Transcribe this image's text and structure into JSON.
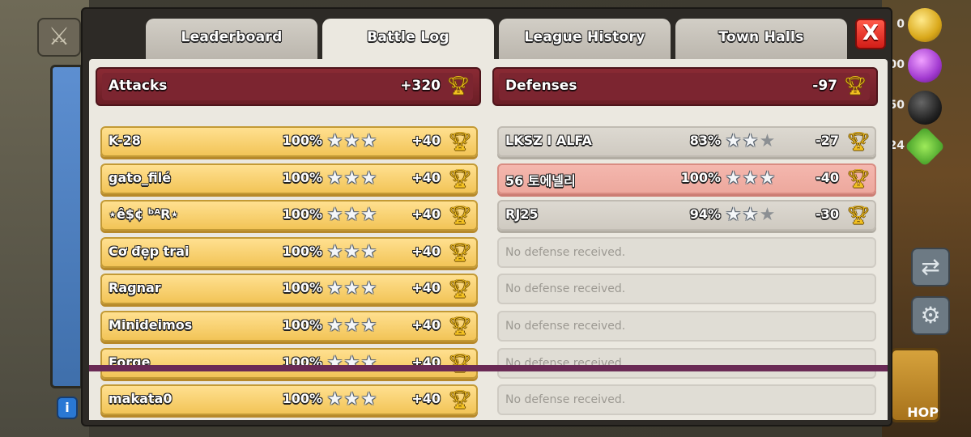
{
  "hud": {
    "resources": [
      {
        "icon": "gold-icon",
        "value": "0"
      },
      {
        "icon": "elixir-icon",
        "value": "00"
      },
      {
        "icon": "dark-elixir-icon",
        "value": "50"
      },
      {
        "icon": "gem-icon",
        "value": "24"
      }
    ],
    "shop_label": "HOP",
    "info_label": "i"
  },
  "tabs": [
    {
      "label": "Leaderboard",
      "active": false
    },
    {
      "label": "Battle Log",
      "active": true
    },
    {
      "label": "League History",
      "active": false
    },
    {
      "label": "Town Halls",
      "active": false
    }
  ],
  "close_label": "X",
  "attacks": {
    "title": "Attacks",
    "total": "+320",
    "rows": [
      {
        "name": "K-28",
        "percent": "100%",
        "stars": 3,
        "trophies": "+40"
      },
      {
        "name": "gato_filé",
        "percent": "100%",
        "stars": 3,
        "trophies": "+40"
      },
      {
        "name": "⋆ê$¢  ᵇᴬR⋆",
        "percent": "100%",
        "stars": 3,
        "trophies": "+40"
      },
      {
        "name": "Cơ đẹp trai",
        "percent": "100%",
        "stars": 3,
        "trophies": "+40"
      },
      {
        "name": "Ragnar",
        "percent": "100%",
        "stars": 3,
        "trophies": "+40"
      },
      {
        "name": "Minideimos",
        "percent": "100%",
        "stars": 3,
        "trophies": "+40"
      },
      {
        "name": "Forge",
        "percent": "100%",
        "stars": 3,
        "trophies": "+40"
      },
      {
        "name": "makata0",
        "percent": "100%",
        "stars": 3,
        "trophies": "+40"
      }
    ]
  },
  "defenses": {
    "title": "Defenses",
    "total": "-97",
    "rows": [
      {
        "name": "LKSZ I ALFA",
        "percent": "83%",
        "stars": 2,
        "trophies": "-27",
        "style": "neutral"
      },
      {
        "name": "56 토에넬리",
        "percent": "100%",
        "stars": 3,
        "trophies": "-40",
        "style": "bad"
      },
      {
        "name": "RJ25",
        "percent": "94%",
        "stars": 2,
        "trophies": "-30",
        "style": "neutral"
      }
    ],
    "empty_rows": [
      "No defense received.",
      "No defense received.",
      "No defense received.",
      "No defense received.",
      "No defense received."
    ]
  },
  "colors": {
    "attack_row": "#f2c457",
    "defense_row_bad": "#eda89d",
    "header_bar": "#7c2530",
    "trophy": "#f3c121"
  }
}
